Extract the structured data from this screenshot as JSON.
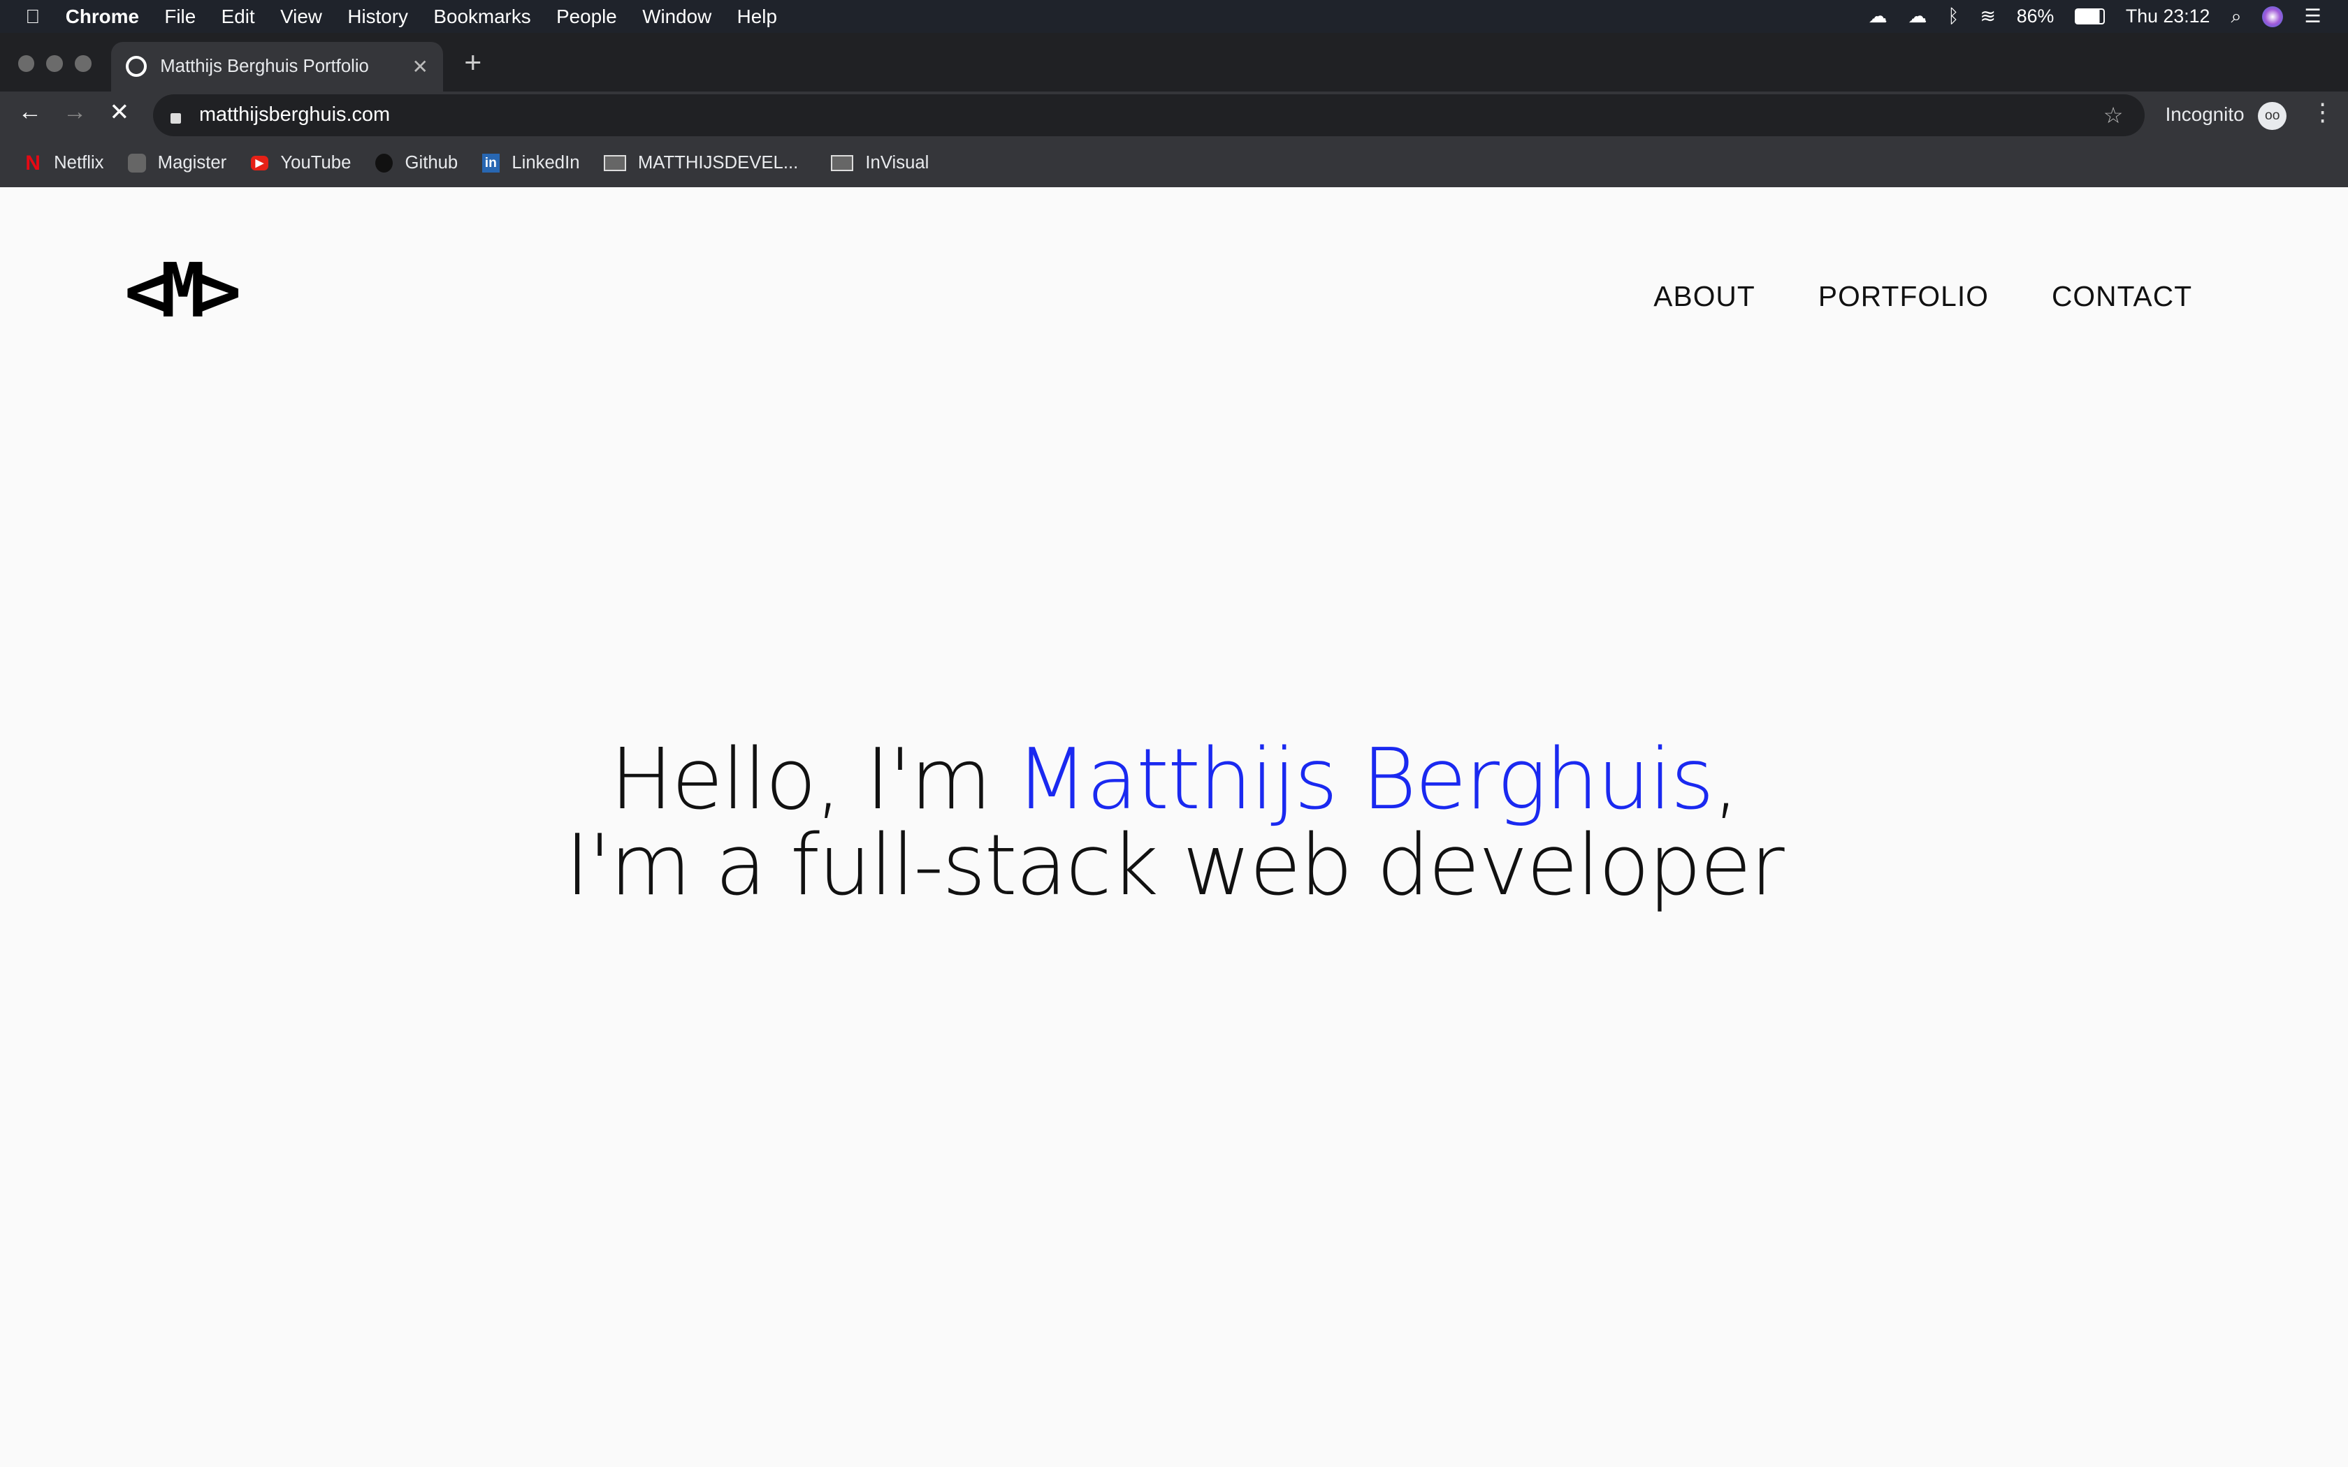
{
  "menubar": {
    "app": "Chrome",
    "items": [
      "File",
      "Edit",
      "View",
      "History",
      "Bookmarks",
      "People",
      "Window",
      "Help"
    ],
    "battery": "86%",
    "clock": "Thu 23:12"
  },
  "tab": {
    "title": "Matthijs Berghuis Portfolio"
  },
  "omnibox": {
    "url": "matthijsberghuis.com"
  },
  "profile": {
    "label": "Incognito"
  },
  "bookmarks": [
    "Netflix",
    "Magister",
    "YouTube",
    "Github",
    "LinkedIn",
    "MATTHIJSDEVEL...",
    "InVisual"
  ],
  "site": {
    "logo": "<M>",
    "nav": [
      "ABOUT",
      "PORTFOLIO",
      "CONTACT"
    ],
    "hero": {
      "greeting": "Hello, I'm ",
      "name": "Matthijs Berghuis",
      "comma": ",",
      "line2": "I'm a full-stack web developer"
    }
  },
  "colors": {
    "accent": "#1a29f0"
  }
}
